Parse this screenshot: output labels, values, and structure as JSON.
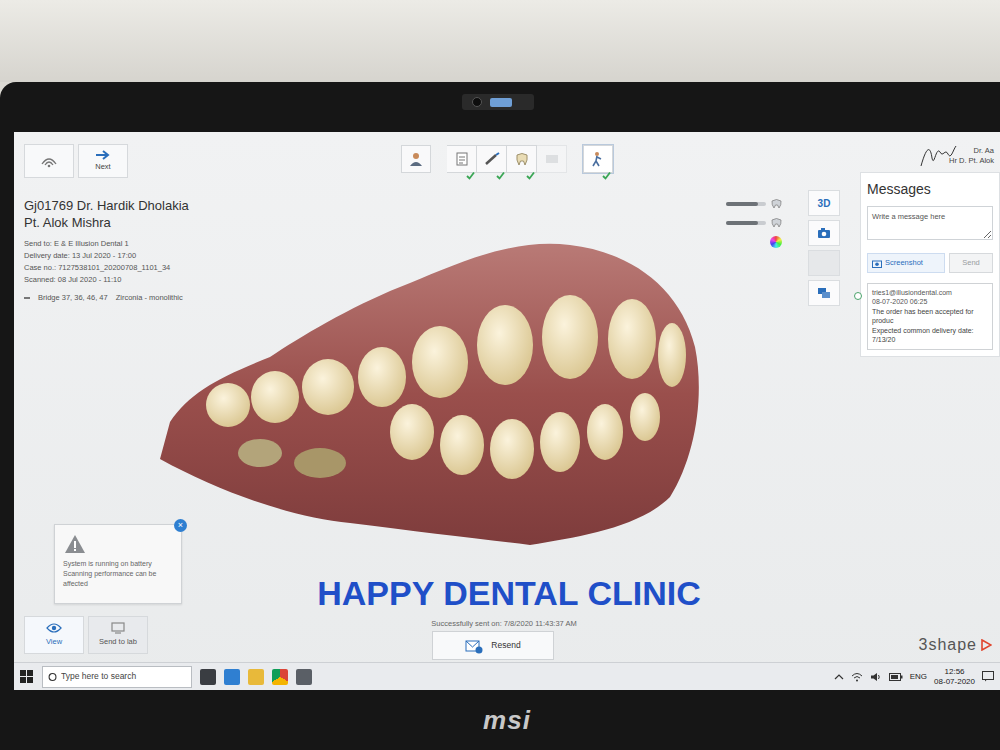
{
  "header": {
    "user_lines": [
      "Dr. Aa",
      "Hr D. Pt. Alok"
    ]
  },
  "nav": {
    "next": "Next"
  },
  "steps": [
    {
      "kind": "patient",
      "done": false,
      "selected": false
    },
    {
      "kind": "order",
      "done": true,
      "selected": false
    },
    {
      "kind": "scan",
      "done": true,
      "selected": false
    },
    {
      "kind": "model",
      "done": true,
      "selected": false
    },
    {
      "kind": "design",
      "done": false,
      "selected": false
    },
    {
      "kind": "send",
      "done": true,
      "selected": true
    }
  ],
  "case": {
    "title": "Gj01769 Dr. Hardik Dholakia",
    "patient": "Pt. Alok Mishra",
    "details": [
      "Send to: E & E Illusion Dental 1",
      "Delivery date: 13 Jul 2020 - 17:00",
      "Case no.: 7127538101_20200708_1101_34",
      "Scanned: 08 Jul 2020 - 11:10"
    ],
    "restoration": {
      "teeth": "Bridge 37, 36, 46, 47",
      "material": "Zirconia - monolithic"
    }
  },
  "viewer": {
    "sliders": [
      {
        "level": 0.8
      },
      {
        "level": 0.8
      }
    ],
    "tools": [
      {
        "kind": "3d",
        "label": "3D",
        "selected": true,
        "disabled": false
      },
      {
        "kind": "camera",
        "selected": false,
        "disabled": false
      },
      {
        "kind": "blank",
        "selected": false,
        "disabled": true
      },
      {
        "kind": "chat",
        "selected": false,
        "disabled": false
      }
    ]
  },
  "watermark": "HAPPY DENTAL CLINIC",
  "status": {
    "sent": "Successfully sent on: 7/8/2020 11:43:37 AM",
    "resend": "Resend"
  },
  "toast": {
    "lines": [
      "System is running on battery",
      "Scanning performance can be affected"
    ],
    "close": "×"
  },
  "view_buttons": [
    {
      "label": "View",
      "selected": true
    },
    {
      "label": "Send to lab",
      "selected": false
    }
  ],
  "messages": {
    "title": "Messages",
    "placeholder": "Write a message here",
    "screenshot": "Screenshot",
    "send": "Send",
    "send_disabled": true,
    "items": [
      {
        "from": "tries1@illusiondental.com",
        "time": "08-07-2020 06:25",
        "lines": [
          "The order has been accepted for produc",
          "Expected common delivery date: 7/13/20"
        ]
      }
    ]
  },
  "brand": "3shape",
  "taskbar": {
    "search": "Type here to search",
    "lang": "ENG",
    "time": "12:56",
    "date": "08-07-2020"
  },
  "bezel": {
    "brand": "msi"
  }
}
